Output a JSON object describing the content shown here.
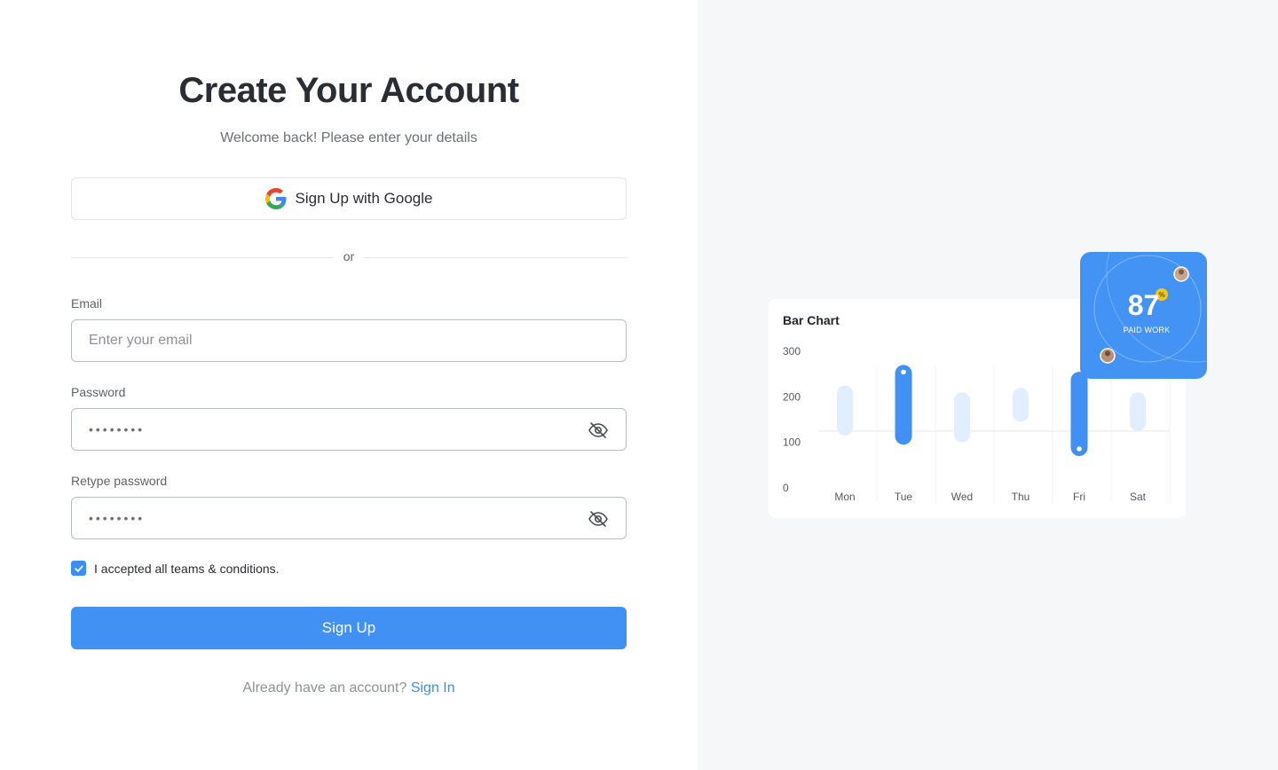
{
  "header": {
    "title": "Create Your Account",
    "subtitle": "Welcome back! Please enter your details"
  },
  "google_button": {
    "label": "Sign Up with Google",
    "icon": "google-icon"
  },
  "divider": {
    "label": "or"
  },
  "email": {
    "label": "Email",
    "placeholder": "Enter your email",
    "value": ""
  },
  "password": {
    "label": "Password",
    "value": "••••••••",
    "icon": "eye-off-icon"
  },
  "retype_password": {
    "label": "Retype password",
    "value": "••••••••",
    "icon": "eye-off-icon"
  },
  "terms": {
    "label": "I accepted all teams & conditions.",
    "checked": true
  },
  "submit": {
    "label": "Sign Up"
  },
  "footer": {
    "prompt": "Already have an account?",
    "link": "Sign In"
  },
  "colors": {
    "accent": "#4191f4",
    "bar_light": "#e1eefd",
    "text_dark": "#2a2d33"
  },
  "badge": {
    "value": "87",
    "label": "PAID WORK",
    "icon": "percent-icon"
  },
  "chart_data": {
    "type": "bar",
    "title": "Bar Chart",
    "categories": [
      "Mon",
      "Tue",
      "Wed",
      "Thu",
      "Fri",
      "Sat"
    ],
    "yticks": [
      "0",
      "100",
      "200",
      "300"
    ],
    "ylim": [
      0,
      300
    ],
    "series": [
      {
        "values": [
          [
            115,
            225
          ],
          [
            95,
            270
          ],
          [
            100,
            210
          ],
          [
            145,
            220
          ],
          [
            70,
            255
          ],
          [
            125,
            210
          ]
        ]
      }
    ],
    "highlighted": [
      "Tue",
      "Fri"
    ],
    "gridline_at": 125
  }
}
